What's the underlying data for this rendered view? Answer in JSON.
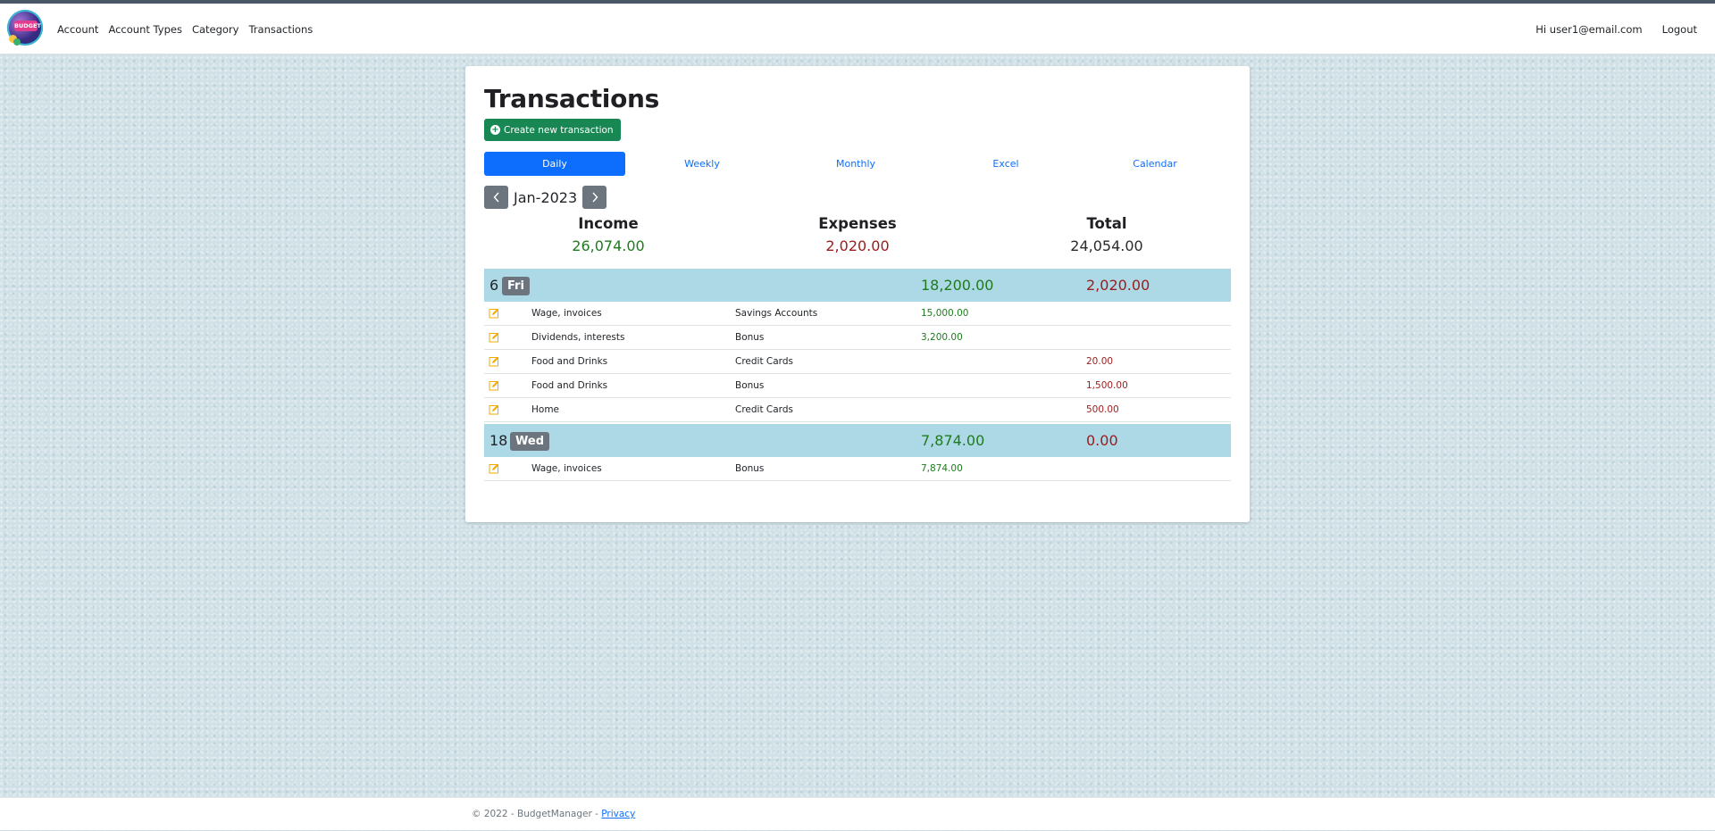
{
  "nav": {
    "logo_text": "BUDGET",
    "links": [
      "Account",
      "Account Types",
      "Category",
      "Transactions"
    ],
    "greeting": "Hi user1@email.com",
    "logout": "Logout"
  },
  "page": {
    "title": "Transactions",
    "create_button": "Create new transaction",
    "tabs": [
      "Daily",
      "Weekly",
      "Monthly",
      "Excel",
      "Calendar"
    ],
    "active_tab": "Daily",
    "month": "Jan-2023"
  },
  "summary": {
    "income_label": "Income",
    "income": "26,074.00",
    "expenses_label": "Expenses",
    "expenses": "2,020.00",
    "total_label": "Total",
    "total": "24,054.00"
  },
  "days": [
    {
      "day": "6",
      "weekday": "Fri",
      "income": "18,200.00",
      "expenses": "2,020.00",
      "transactions": [
        {
          "category": "Wage, invoices",
          "account": "Savings Accounts",
          "income": "15,000.00",
          "expense": ""
        },
        {
          "category": "Dividends, interests",
          "account": "Bonus",
          "income": "3,200.00",
          "expense": ""
        },
        {
          "category": "Food and Drinks",
          "account": "Credit Cards",
          "income": "",
          "expense": "20.00"
        },
        {
          "category": "Food and Drinks",
          "account": "Bonus",
          "income": "",
          "expense": "1,500.00"
        },
        {
          "category": "Home",
          "account": "Credit Cards",
          "income": "",
          "expense": "500.00"
        }
      ]
    },
    {
      "day": "18",
      "weekday": "Wed",
      "income": "7,874.00",
      "expenses": "0.00",
      "transactions": [
        {
          "category": "Wage, invoices",
          "account": "Bonus",
          "income": "7,874.00",
          "expense": ""
        }
      ]
    }
  ],
  "footer": {
    "copyright": "© 2022 - BudgetManager - ",
    "privacy": "Privacy"
  },
  "colors": {
    "primary": "#0d6efd",
    "success": "#198754",
    "secondary": "#6c757d",
    "day_row": "#add8e6",
    "income": "#1e7b1e",
    "expense": "#9b1c1c"
  }
}
